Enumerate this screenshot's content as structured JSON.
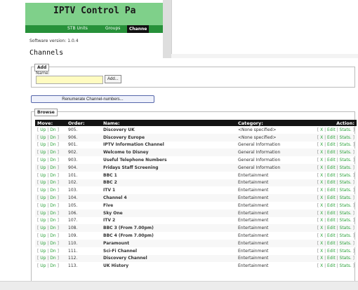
{
  "header": {
    "title": "IPTV Control Pa",
    "nav": [
      "STB Units",
      "Groups",
      "Channe"
    ],
    "active_nav": 2
  },
  "software_version": "Software version: 1.0.4",
  "page_title": "Channels",
  "add_section": {
    "legend": "Add",
    "name_label": "Name:",
    "name_value": "",
    "add_button": "Add..."
  },
  "renumerate_button": "Renumerate Channel-numbers...",
  "browse": {
    "legend": "Browse",
    "columns": [
      "Move:",
      "Order:",
      "Name:",
      "Category:",
      "Action:"
    ],
    "move_links": [
      "Up",
      "Dn"
    ],
    "action_links": [
      "X",
      "Edit",
      "Stats."
    ],
    "rows": [
      {
        "order": "905.",
        "name": "Discovery UK",
        "category": "<None specified>"
      },
      {
        "order": "906.",
        "name": "Discovery Europe",
        "category": "<None specified>"
      },
      {
        "order": "901.",
        "name": "IPTV Information Channel",
        "category": "General Information"
      },
      {
        "order": "902.",
        "name": "Welcome to Disney",
        "category": "General Information"
      },
      {
        "order": "903.",
        "name": "Useful Telephone Numbers",
        "category": "General Information"
      },
      {
        "order": "904.",
        "name": "Fridays Staff Screening",
        "category": "General Information"
      },
      {
        "order": "101.",
        "name": "BBC 1",
        "category": "Entertainment"
      },
      {
        "order": "102.",
        "name": "BBC 2",
        "category": "Entertainment"
      },
      {
        "order": "103.",
        "name": "ITV 1",
        "category": "Entertainment"
      },
      {
        "order": "104.",
        "name": "Channel 4",
        "category": "Entertainment"
      },
      {
        "order": "105.",
        "name": "Five",
        "category": "Entertainment"
      },
      {
        "order": "106.",
        "name": "Sky One",
        "category": "Entertainment"
      },
      {
        "order": "107.",
        "name": "ITV 2",
        "category": "Entertainment"
      },
      {
        "order": "108.",
        "name": "BBC 3 (From 7.00pm)",
        "category": "Entertainment"
      },
      {
        "order": "109.",
        "name": "BBC 4 (From 7.00pm)",
        "category": "Entertainment"
      },
      {
        "order": "110.",
        "name": "Paramount",
        "category": "Entertainment"
      },
      {
        "order": "111.",
        "name": "Sci-Fi Channel",
        "category": "Entertainment"
      },
      {
        "order": "112.",
        "name": "Discovery Channel",
        "category": "Entertainment"
      },
      {
        "order": "113.",
        "name": "UK History",
        "category": "Entertainment"
      }
    ]
  }
}
